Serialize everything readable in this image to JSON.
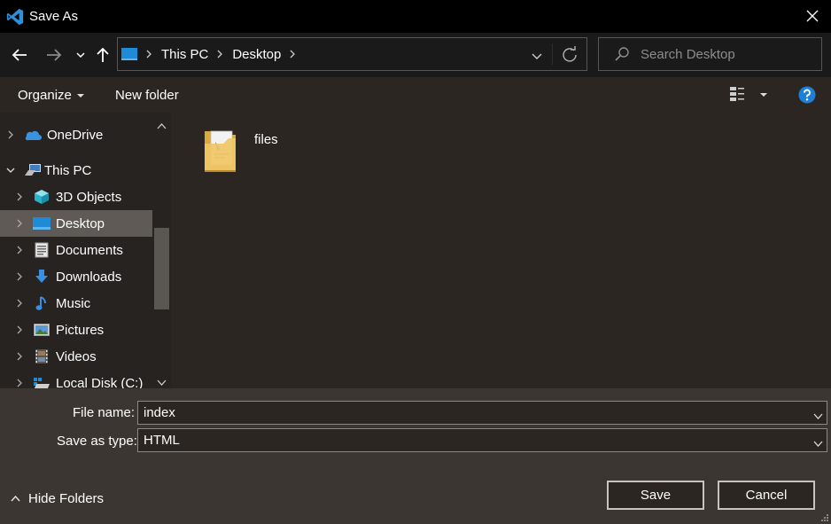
{
  "window": {
    "title": "Save As",
    "icon": "vscode-icon",
    "close_icon": "close-icon"
  },
  "nav": {
    "back_icon": "arrow-left-icon",
    "forward_icon": "arrow-right-icon",
    "recent_icon": "chevron-down-icon",
    "up_icon": "arrow-up-icon",
    "breadcrumbs": [
      "This PC",
      "Desktop"
    ],
    "refresh_icon": "refresh-icon"
  },
  "search": {
    "placeholder": "Search Desktop"
  },
  "toolbar": {
    "organize_label": "Organize",
    "new_folder_label": "New folder",
    "view_icon": "view-options-icon",
    "help_icon": "help-icon"
  },
  "sidebar": {
    "items": [
      {
        "label": "OneDrive",
        "icon": "onedrive-icon",
        "expanded": false
      },
      {
        "label": "This PC",
        "icon": "computer-icon",
        "expanded": true
      },
      {
        "label": "3D Objects",
        "icon": "cube-icon",
        "expanded": false
      },
      {
        "label": "Desktop",
        "icon": "desktop-icon",
        "expanded": false,
        "selected": true
      },
      {
        "label": "Documents",
        "icon": "document-icon",
        "expanded": false
      },
      {
        "label": "Downloads",
        "icon": "download-icon",
        "expanded": false
      },
      {
        "label": "Music",
        "icon": "music-note-icon",
        "expanded": false
      },
      {
        "label": "Pictures",
        "icon": "picture-icon",
        "expanded": false
      },
      {
        "label": "Videos",
        "icon": "film-icon",
        "expanded": false
      },
      {
        "label": "Local Disk (C:)",
        "icon": "drive-icon",
        "expanded": false
      }
    ]
  },
  "content": {
    "files": [
      {
        "name": "files",
        "icon": "folder-icon"
      }
    ]
  },
  "form": {
    "file_name_label": "File name:",
    "file_name_value": "index",
    "save_type_label": "Save as type:",
    "save_type_value": "HTML"
  },
  "actions": {
    "save_label": "Save",
    "cancel_label": "Cancel",
    "hide_folders_label": "Hide Folders"
  },
  "colors": {
    "accent": "#2f8fd8",
    "window_bg": "#2b2621",
    "selected_bg": "#5f5a55"
  }
}
